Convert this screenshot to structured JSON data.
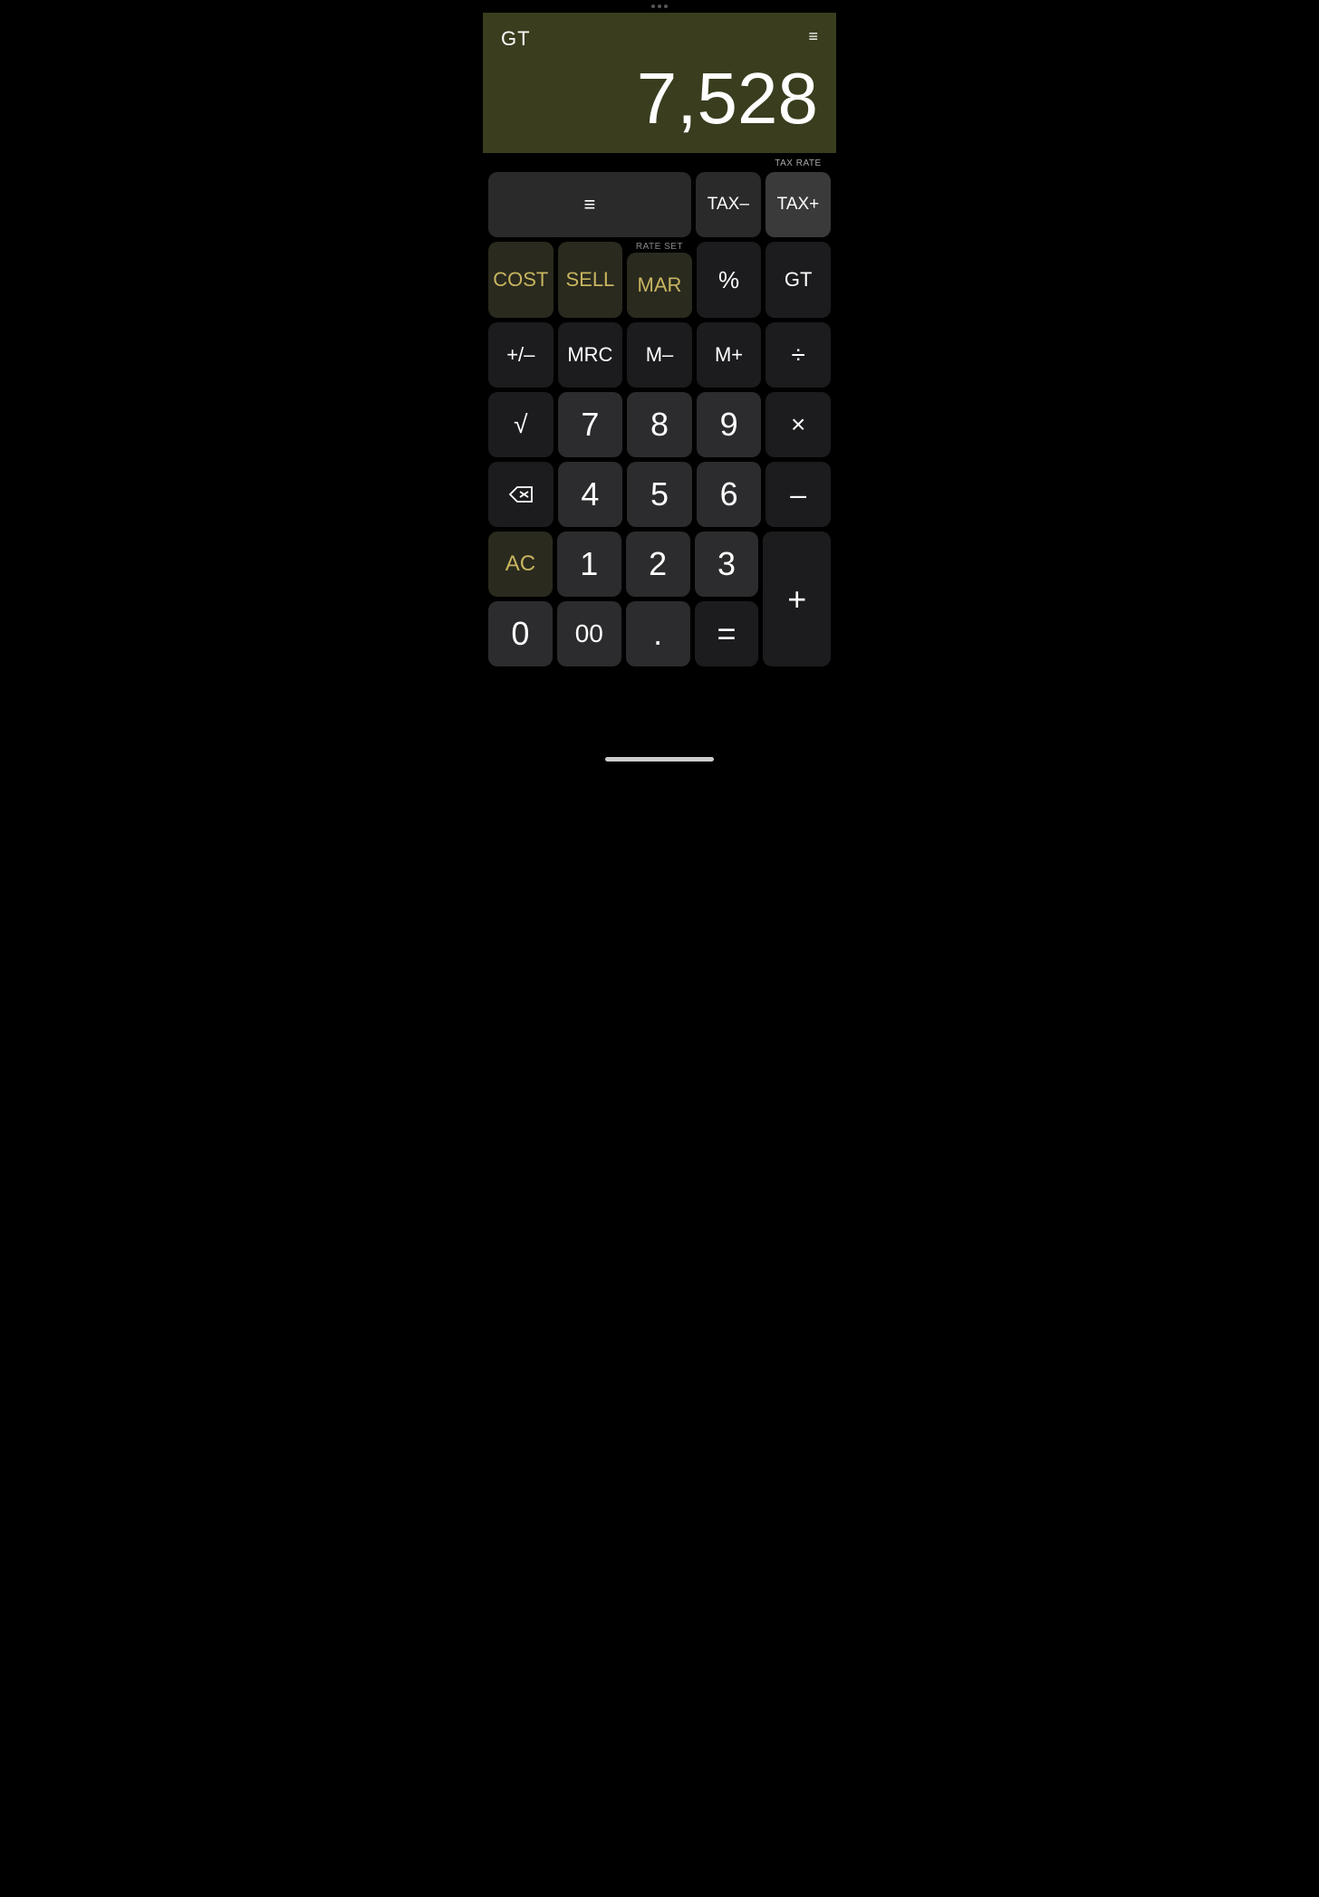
{
  "status_bar": {
    "dots": 3
  },
  "display": {
    "gt_label": "GT",
    "menu_icon": "≡",
    "value": "7,528"
  },
  "tax_area": {
    "tax_rate_label": "TAX RATE",
    "rate_set_label": "RATE SET",
    "tax_minus_label": "TAX–",
    "tax_plus_label": "TAX+"
  },
  "buttons": {
    "menu": "≡",
    "cost": "COST",
    "sell": "SELL",
    "mar": "MAR",
    "percent": "%",
    "gt": "GT",
    "plus_minus": "+/–",
    "mrc": "MRC",
    "m_minus": "M–",
    "m_plus": "M+",
    "divide": "÷",
    "sqrt": "√",
    "seven": "7",
    "eight": "8",
    "nine": "9",
    "multiply": "×",
    "backspace": "⌫",
    "four": "4",
    "five": "5",
    "six": "6",
    "subtract": "–",
    "ac": "AC",
    "one": "1",
    "two": "2",
    "three": "3",
    "plus": "+",
    "zero": "0",
    "double_zero": "00",
    "dot": ".",
    "equals": "="
  }
}
